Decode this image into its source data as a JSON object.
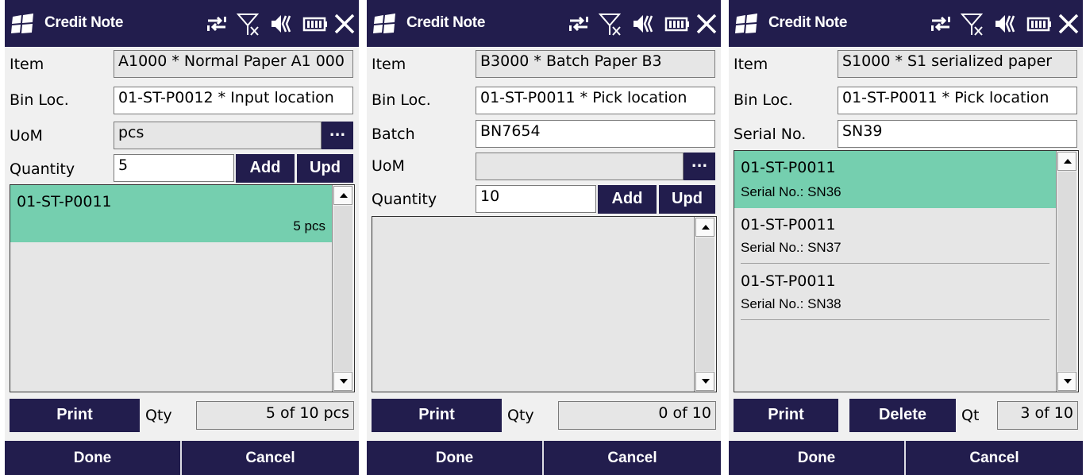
{
  "colors": {
    "titlebar": "#221d4d",
    "selected_row": "#75cfaf",
    "button": "#221d4d"
  },
  "icons": [
    "windows-logo-icon",
    "connectivity-icon",
    "no-signal-icon",
    "volume-icon",
    "battery-icon",
    "close-icon"
  ],
  "screens": [
    {
      "title": "Credit Note",
      "item": {
        "label": "Item",
        "value": "A1000 * Normal Paper A1 000"
      },
      "bin": {
        "label": "Bin Loc.",
        "value": "01-ST-P0012 * Input location"
      },
      "uom": {
        "label": "UoM",
        "value": "pcs",
        "button": "..."
      },
      "quantity": {
        "label": "Quantity",
        "value": "5"
      },
      "add_label": "Add",
      "upd_label": "Upd",
      "list": [
        {
          "bin": "01-ST-P0011",
          "qty": "5 pcs"
        }
      ],
      "print_label": "Print",
      "qty_label": "Qty",
      "qty_value": "5 of 10 pcs",
      "done_label": "Done",
      "cancel_label": "Cancel"
    },
    {
      "title": "Credit Note",
      "item": {
        "label": "Item",
        "value": "B3000 * Batch Paper B3"
      },
      "bin": {
        "label": "Bin Loc.",
        "value": "01-ST-P0011 * Pick location"
      },
      "batch": {
        "label": "Batch",
        "value": "BN7654"
      },
      "uom": {
        "label": "UoM",
        "value": "",
        "button": "..."
      },
      "quantity": {
        "label": "Quantity",
        "value": "10"
      },
      "add_label": "Add",
      "upd_label": "Upd",
      "print_label": "Print",
      "qty_label": "Qty",
      "qty_value": "0 of 10",
      "done_label": "Done",
      "cancel_label": "Cancel"
    },
    {
      "title": "Credit Note",
      "item": {
        "label": "Item",
        "value": "S1000 * S1 serialized paper"
      },
      "bin": {
        "label": "Bin Loc.",
        "value": "01-ST-P0011 * Pick location"
      },
      "serial": {
        "label": "Serial No.",
        "value": "SN39"
      },
      "list": [
        {
          "bin": "01-ST-P0011",
          "serial": "Serial No.: SN36"
        },
        {
          "bin": "01-ST-P0011",
          "serial": "Serial No.: SN37"
        },
        {
          "bin": "01-ST-P0011",
          "serial": "Serial No.: SN38"
        }
      ],
      "print_label": "Print",
      "delete_label": "Delete",
      "qty_label": "Qt",
      "qty_value": "3 of 10",
      "done_label": "Done",
      "cancel_label": "Cancel"
    }
  ]
}
